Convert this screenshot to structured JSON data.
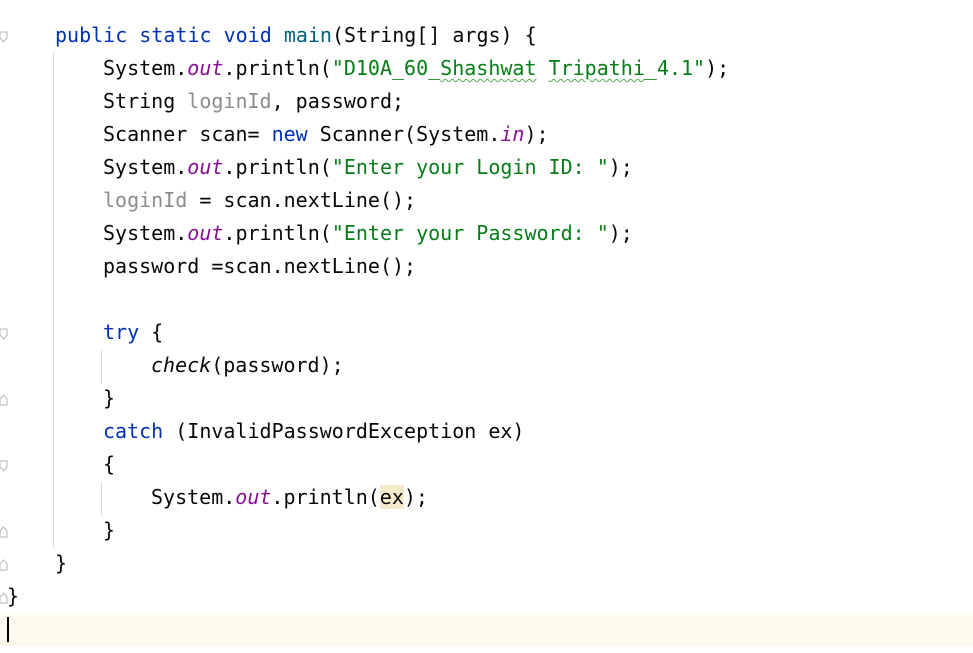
{
  "editor": {
    "lines": [
      {
        "t1": "public",
        "t2": "static",
        "t3": "void",
        "t4": "main",
        "t5": "(String[] args) {"
      },
      {
        "a": "System.",
        "b": "out",
        "c": ".println(",
        "d": "\"D10A_60_",
        "e": "Shashwat",
        "f": "Tripathi",
        "g": "_4.1\"",
        "h": ");"
      },
      {
        "a": "String ",
        "b": "loginId",
        "c": ", password;"
      },
      {
        "a": "Scanner scan= ",
        "b": "new",
        "c": " Scanner(System.",
        "d": "in",
        "e": ");"
      },
      {
        "a": "System.",
        "b": "out",
        "c": ".println(",
        "d": "\"Enter your Login ID: \"",
        "e": ");"
      },
      {
        "a": "loginId",
        "b": " = scan.nextLine();"
      },
      {
        "a": "System.",
        "b": "out",
        "c": ".println(",
        "d": "\"Enter your Password: \"",
        "e": ");"
      },
      {
        "a": "password =scan.nextLine();"
      },
      {
        "a": "try",
        "b": " {"
      },
      {
        "a": "check",
        "b": "(password);"
      },
      {
        "a": "}"
      },
      {
        "a": "catch",
        "b": " (InvalidPasswordException ex)"
      },
      {
        "a": "{"
      },
      {
        "a": "System.",
        "b": "out",
        "c": ".println(",
        "d": "ex",
        "e": ");"
      },
      {
        "a": "}"
      },
      {
        "a": "}"
      },
      {
        "a": "}"
      }
    ]
  },
  "colors": {
    "keyword": "#0033b3",
    "method_decl": "#00627a",
    "string": "#067d17",
    "static_field": "#871094",
    "unused_var": "#8c8c8c",
    "current_line": "#fcfaed"
  }
}
